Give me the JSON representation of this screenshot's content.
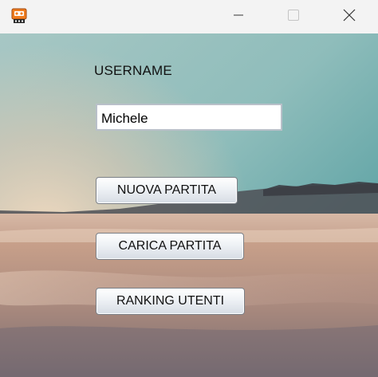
{
  "titlebar": {
    "app_icon": "game-controller-icon",
    "minimize_icon": "minimize-icon",
    "maximize_icon": "maximize-icon",
    "close_icon": "close-icon"
  },
  "form": {
    "username_label": "USERNAME",
    "username_value": "Michele"
  },
  "buttons": {
    "new_game": "NUOVA PARTITA",
    "load_game": "CARICA PARTITA",
    "ranking": "RANKING UTENTI"
  },
  "colors": {
    "titlebar_bg": "#f3f3f3",
    "sky_teal": "#4f9ea0",
    "sand": "#c9a18b"
  }
}
